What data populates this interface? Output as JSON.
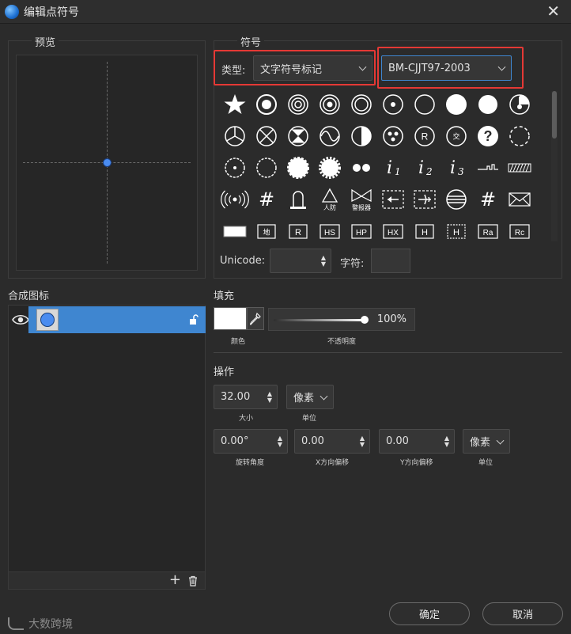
{
  "window": {
    "title": "编辑点符号",
    "close_glyph": "✕"
  },
  "preview": {
    "title": "预览",
    "dot_color": "#4a8cf0"
  },
  "symbol": {
    "title": "符号",
    "type_label": "类型:",
    "type_value": "文字符号标记",
    "standard_value": "BM-CJJT97-2003",
    "unicode_label": "Unicode:",
    "unicode_value": "",
    "char_label": "字符:",
    "char_value": "",
    "grid_text": {
      "r": "R",
      "jiao": "交",
      "q": "?",
      "i1": "i",
      "i1_sub": "1",
      "i2": "i",
      "i2_sub": "2",
      "i3": "i",
      "i3_sub": "3",
      "hash": "#",
      "renfang": "人防",
      "jingbaoqi": "警报器",
      "di": "地",
      "R": "R",
      "HS": "HS",
      "HP": "HP",
      "HX": "HX",
      "H": "H",
      "H2": "H",
      "Ra": "Ra",
      "Rc": "Rc"
    }
  },
  "composite": {
    "title": "合成图标",
    "add_glyph": "+",
    "layer_color": "#4a8cf0"
  },
  "fill": {
    "title": "填充",
    "color_caption": "颜色",
    "opacity_caption": "不透明度",
    "opacity_value": "100%",
    "opacity_fraction": 1.0,
    "color": "#ffffff"
  },
  "operation": {
    "title": "操作",
    "size_value": "32.00",
    "size_caption": "大小",
    "unit_value": "像素",
    "unit_caption": "单位",
    "rotation_value": "0.00°",
    "rotation_caption": "旋转角度",
    "xoffset_value": "0.00",
    "xoffset_caption": "X方向偏移",
    "yoffset_value": "0.00",
    "yoffset_caption": "Y方向偏移",
    "unit2_value": "像素",
    "unit2_caption": "单位"
  },
  "buttons": {
    "ok": "确定",
    "cancel": "取消"
  },
  "watermark": {
    "text": "大数跨境"
  },
  "colors": {
    "accent": "#3f86d0",
    "highlight": "#e53935",
    "bg": "#2b2b2b"
  }
}
